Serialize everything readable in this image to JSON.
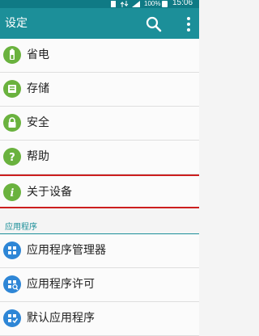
{
  "status_bar": {
    "battery_percent": "100%",
    "time": "15:06"
  },
  "header": {
    "title": "设定"
  },
  "settings_items": [
    {
      "label": "省电",
      "icon": "battery-saver-icon",
      "color": "#6ab23e"
    },
    {
      "label": "存储",
      "icon": "storage-icon",
      "color": "#6ab23e"
    },
    {
      "label": "安全",
      "icon": "lock-icon",
      "color": "#6ab23e"
    },
    {
      "label": "帮助",
      "icon": "help-icon",
      "color": "#6ab23e"
    },
    {
      "label": "关于设备",
      "icon": "info-icon",
      "color": "#6ab23e"
    }
  ],
  "apps_section": {
    "header": "应用程序",
    "items": [
      {
        "label": "应用程序管理器",
        "icon": "app-manager-icon",
        "color": "#2e86d6"
      },
      {
        "label": "应用程序许可",
        "icon": "app-permissions-icon",
        "color": "#2e86d6"
      },
      {
        "label": "默认应用程序",
        "icon": "default-apps-icon",
        "color": "#2e86d6"
      }
    ]
  },
  "colors": {
    "toolbar": "#1c8f99",
    "highlight_border": "#cc1f1f"
  }
}
